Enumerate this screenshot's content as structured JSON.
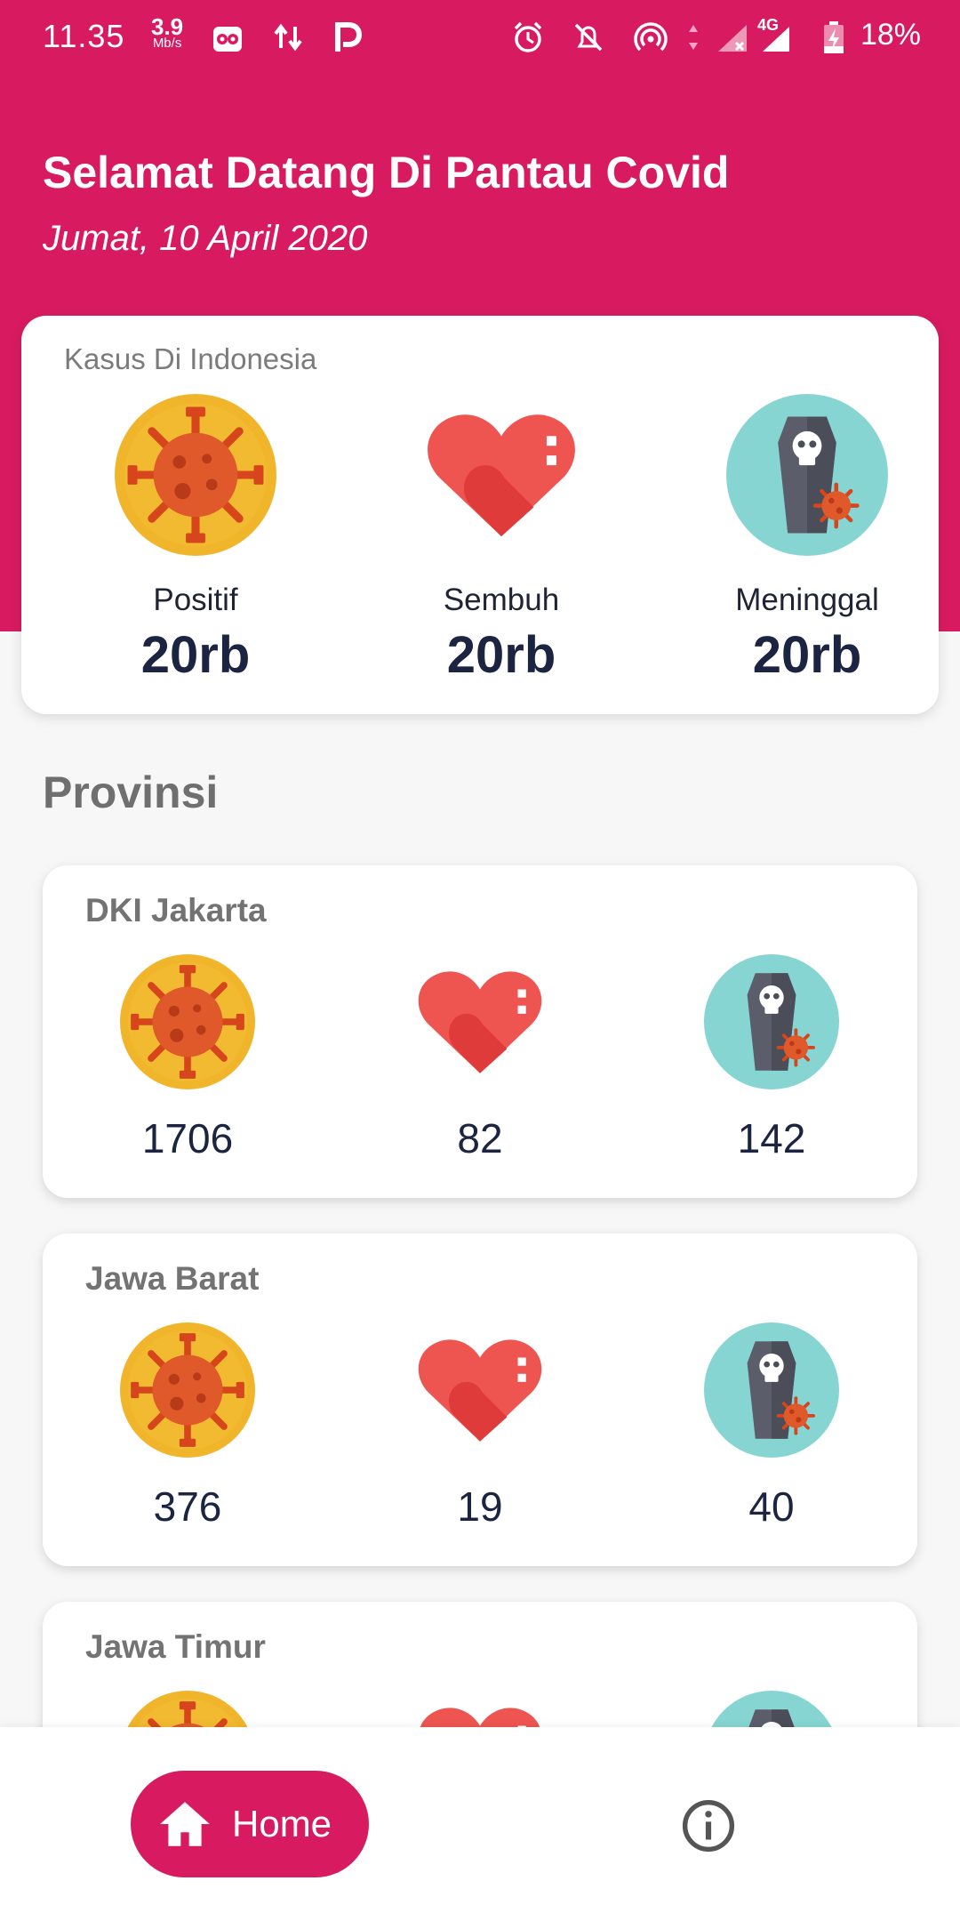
{
  "status_bar": {
    "time": "11.35",
    "speed_value": "3.9",
    "speed_unit": "Mb/s",
    "network": "4G",
    "battery": "18%"
  },
  "header": {
    "welcome": "Selamat Datang Di Pantau Covid",
    "date": "Jumat, 10 April 2020"
  },
  "summary": {
    "title": "Kasus Di Indonesia",
    "stats": [
      {
        "label": "Positif",
        "value": "20rb",
        "icon": "virus-icon"
      },
      {
        "label": "Sembuh",
        "value": "20rb",
        "icon": "heart-icon"
      },
      {
        "label": "Meninggal",
        "value": "20rb",
        "icon": "coffin-icon"
      }
    ]
  },
  "section_title": "Provinsi",
  "provinces": [
    {
      "name": "DKI Jakarta",
      "positif": "1706",
      "sembuh": "82",
      "meninggal": "142"
    },
    {
      "name": "Jawa Barat",
      "positif": "376",
      "sembuh": "19",
      "meninggal": "40"
    },
    {
      "name": "Jawa Timur",
      "positif": "",
      "sembuh": "",
      "meninggal": ""
    }
  ],
  "nav": {
    "home_label": "Home",
    "home_icon": "home-icon",
    "info_icon": "info-icon"
  },
  "colors": {
    "primary": "#d81b60",
    "text_dark": "#1b2440",
    "virus_yellow": "#f2b82a",
    "heart_red": "#e84a4a",
    "coffin_teal": "#7fd3d0"
  }
}
